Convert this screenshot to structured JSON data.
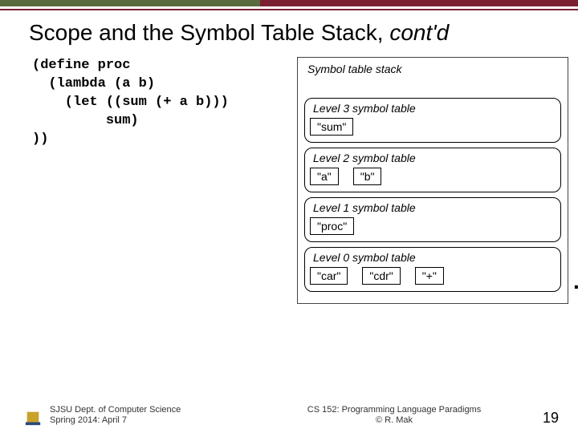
{
  "header": {
    "title_plain": "Scope and the Symbol Table Stack, ",
    "title_italic": "cont'd"
  },
  "code": {
    "l1": "(define proc",
    "l2": "  (lambda (a b)",
    "l3": "    (let ((sum (+ a b)))",
    "l4": "         sum)",
    "l5": "))"
  },
  "stack": {
    "title": "Symbol table stack",
    "levels": [
      {
        "title": "Level 3 symbol table",
        "entries": [
          "\"sum\""
        ]
      },
      {
        "title": "Level 2 symbol table",
        "entries": [
          "\"a\"",
          "\"b\""
        ]
      },
      {
        "title": "Level 1 symbol table",
        "entries": [
          "\"proc\""
        ]
      },
      {
        "title": "Level 0 symbol table",
        "entries": [
          "\"car\"",
          "\"cdr\"",
          "\"+\""
        ],
        "ellipsis": "..."
      }
    ]
  },
  "footer": {
    "left_line1": "SJSU Dept. of Computer Science",
    "left_line2": "Spring 2014: April 7",
    "center_line1": "CS 152: Programming Language Paradigms",
    "center_line2": "© R. Mak",
    "page": "19"
  }
}
